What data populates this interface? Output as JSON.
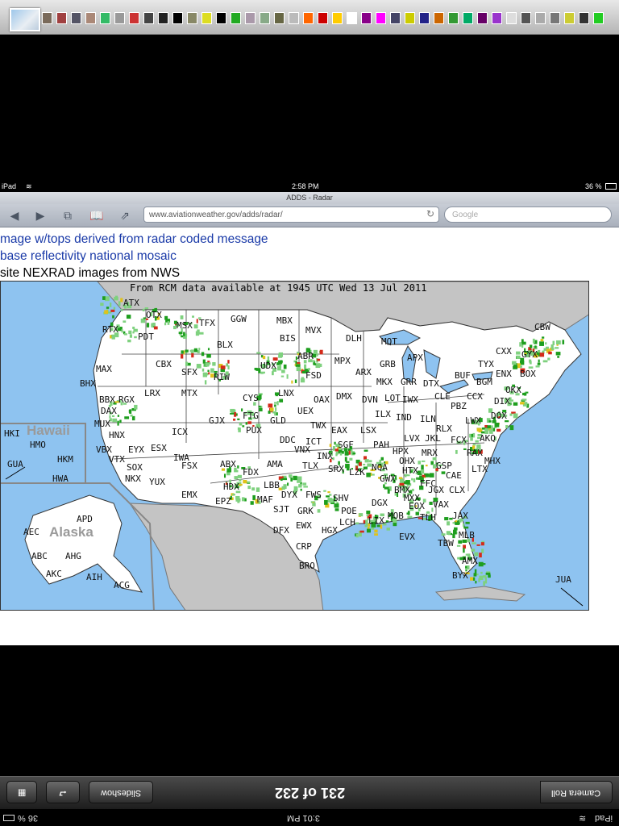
{
  "status_bar": {
    "device": "iPad",
    "time": "2:58 PM",
    "battery": "36 %"
  },
  "safari": {
    "title": "ADDS - Radar",
    "url": "www.aviationweather.gov/adds/radar/",
    "search_placeholder": "Google"
  },
  "page": {
    "line1": "mage w/tops derived from radar coded message",
    "line2": "base reflectivity national mosaic",
    "line3": "site NEXRAD images from NWS"
  },
  "map": {
    "header": "From RCM data available at 1945 UTC Wed 13 Jul 2011",
    "region_hawaii": "Hawaii",
    "region_alaska": "Alaska",
    "colors": {
      "ocean": "#8ec3f0",
      "land": "#ffffff",
      "foreign": "#c4c4c4",
      "echo_light": "#7fd17f",
      "echo_mid": "#1e9e1e",
      "echo_heavy": "#e0c21a",
      "echo_intense": "#d42a1a"
    },
    "sites": [
      "ATX",
      "OTX",
      "RTX",
      "PDT",
      "MSX",
      "TFX",
      "GGW",
      "MBX",
      "MVX",
      "DLH",
      "MQT",
      "CBW",
      "BIS",
      "ABR",
      "MPX",
      "APX",
      "GRB",
      "TYX",
      "CXX",
      "GYX",
      "ENX",
      "BOX",
      "BUF",
      "BGM",
      "OKX",
      "MAX",
      "CBX",
      "SFX",
      "BLX",
      "UDX",
      "FSD",
      "ARX",
      "MKX",
      "GRR",
      "DTX",
      "BHX",
      "BBX",
      "RGX",
      "LRX",
      "MTX",
      "RIW",
      "CYS",
      "LNX",
      "OAX",
      "DMX",
      "DVN",
      "LOT",
      "IWX",
      "CLE",
      "PBZ",
      "CCX",
      "DIX",
      "DAX",
      "MUX",
      "HNX",
      "ICX",
      "GJX",
      "FTG",
      "PUX",
      "GLD",
      "UEX",
      "TWX",
      "EAX",
      "ILX",
      "IND",
      "ILN",
      "RLX",
      "LWX",
      "DOX",
      "AKQ",
      "HKI",
      "HMO",
      "HKM",
      "HWA",
      "GUA",
      "VBX",
      "EYX",
      "ESX",
      "VTX",
      "SOX",
      "NKX",
      "YUX",
      "IWA",
      "FSX",
      "EMX",
      "EPZ",
      "HDX",
      "ABX",
      "FDX",
      "AMA",
      "LBB",
      "MAF",
      "SJT",
      "DYX",
      "FWS",
      "GRK",
      "EWX",
      "DFX",
      "CRP",
      "BRO",
      "HGX",
      "LCH",
      "POE",
      "SHV",
      "LZK",
      "SRX",
      "TLX",
      "INX",
      "VNX",
      "DDC",
      "ICT",
      "SGF",
      "PAH",
      "LSX",
      "HPX",
      "LVX",
      "JKL",
      "FCX",
      "RAX",
      "MRX",
      "OHX",
      "HTX",
      "GSP",
      "CAE",
      "LTX",
      "MHX",
      "NQA",
      "GWX",
      "BMX",
      "FFC",
      "JGX",
      "CLX",
      "MXX",
      "EOX",
      "VAX",
      "TLH",
      "JAX",
      "MOB",
      "DGX",
      "LIX",
      "EVX",
      "TBW",
      "MLB",
      "AMX",
      "BYX",
      "JUA",
      "APD",
      "AEC",
      "ABC",
      "AHG",
      "AKC",
      "AIH",
      "ACG"
    ]
  },
  "bottom": {
    "slideshow": "Slideshow",
    "counter": "231 of 232",
    "camera_roll": "Camera Roll",
    "device": "iPad",
    "time": "3:01 PM",
    "battery": "36 %"
  }
}
